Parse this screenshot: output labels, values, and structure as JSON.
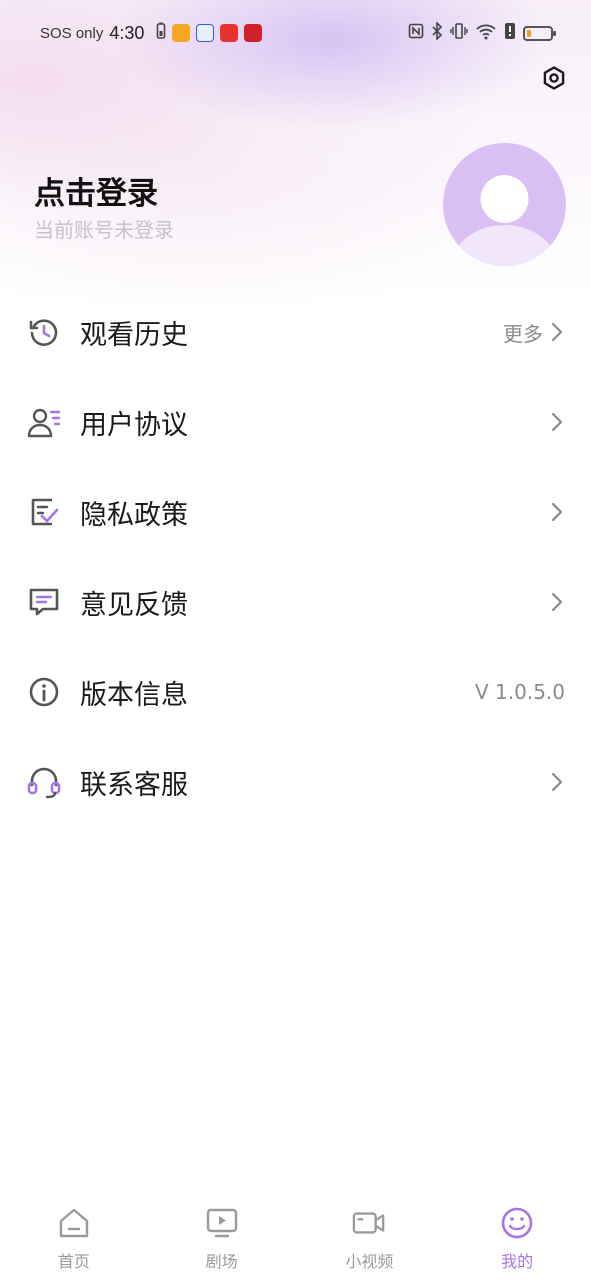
{
  "status_bar": {
    "carrier": "SOS only",
    "time": "4:30",
    "app_icon_colors": [
      "#f5a623",
      "#2b5fd9",
      "#e8322d",
      "#d0202a"
    ],
    "battery_level": 0.2
  },
  "header": {
    "settings_icon": "settings-gear-icon",
    "login_title": "点击登录",
    "login_subtitle": "当前账号未登录",
    "avatar_color": "#d9bff3"
  },
  "menu": {
    "items": [
      {
        "label": "观看历史",
        "icon": "history-icon",
        "extra": "更多",
        "chevron": true
      },
      {
        "label": "用户协议",
        "icon": "user-agreement-icon",
        "extra": "",
        "chevron": true
      },
      {
        "label": "隐私政策",
        "icon": "privacy-policy-icon",
        "extra": "",
        "chevron": true
      },
      {
        "label": "意见反馈",
        "icon": "feedback-icon",
        "extra": "",
        "chevron": true
      },
      {
        "label": "版本信息",
        "icon": "info-icon",
        "extra": "V 1.0.5.0",
        "chevron": false
      },
      {
        "label": "联系客服",
        "icon": "headset-icon",
        "extra": "",
        "chevron": true
      }
    ]
  },
  "tabbar": {
    "tabs": [
      {
        "label": "首页",
        "icon": "home-icon",
        "active": false
      },
      {
        "label": "剧场",
        "icon": "play-screen-icon",
        "active": false
      },
      {
        "label": "小视频",
        "icon": "video-camera-icon",
        "active": false
      },
      {
        "label": "我的",
        "icon": "smiley-icon",
        "active": true
      }
    ]
  },
  "colors": {
    "accent": "#a873e8",
    "icon_gray": "#555555",
    "text_muted": "#8a8a8e"
  }
}
